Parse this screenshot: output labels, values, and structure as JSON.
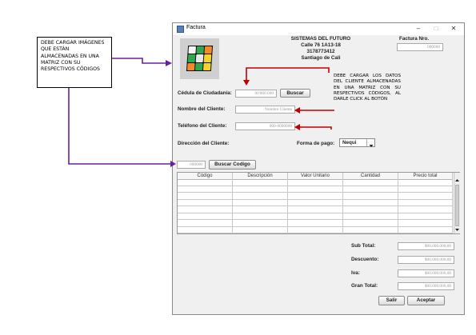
{
  "callout": {
    "text": "DEBE CARGAR IMÁGENES QUE ESTÁN ALMACENADAS EN UNA MATRIZ CON SU RESPECTIVOS CÓDIGOS"
  },
  "window": {
    "title": "Factura",
    "minimize_glyph": "–",
    "maximize_glyph": "□",
    "close_glyph": "✕"
  },
  "company": {
    "name": "SISTEMAS DEL FUTURO",
    "address": "Calle 76 1A13-18",
    "phone": "3178773412",
    "city": "Santiago de Cali"
  },
  "invoice": {
    "label": "Factura Nro.",
    "placeholder": "000000"
  },
  "customer": {
    "id_label": "Cédula de Ciudadanía:",
    "id_placeholder": "00'000.000",
    "search_button": "Buscar",
    "name_label": "Nombre del Cliente:",
    "name_placeholder": "Nombre Cliente",
    "phone_label": "Teléfono del Cliente:",
    "phone_placeholder": "000-0000000",
    "address_label": "Dirección del Cliente:"
  },
  "payment": {
    "label": "Forma de pago:",
    "selected": "Nequi"
  },
  "note": {
    "text": "DEBE CARGAR LOS DATOS DEL CLIENTE ALMACENADAS EN UNA MATRIZ CON SU RESPECTIVOS CÓDIGOS, AL DARLE CLICK AL BOTÓN"
  },
  "code_search": {
    "placeholder": "000000",
    "button": "Buscar Codigo"
  },
  "table": {
    "columns": [
      "Código",
      "Descripción",
      "Valor Unitario",
      "Cantidad",
      "Precio total"
    ],
    "row_count": 8
  },
  "totals": {
    "subtotal_label": "Sub Total:",
    "discount_label": "Descuento:",
    "iva_label": "Iva:",
    "grand_total_label": "Gran Total:",
    "placeholder": "$00.000.000,00"
  },
  "actions": {
    "exit": "Salir",
    "accept": "Aceptar"
  },
  "colors": {
    "arrow_red": "#c00000",
    "arrow_purple": "#6a1fa0"
  },
  "icons": {
    "cube": "rubiks-cube-icon",
    "dropdown": "chevron-down-icon"
  }
}
